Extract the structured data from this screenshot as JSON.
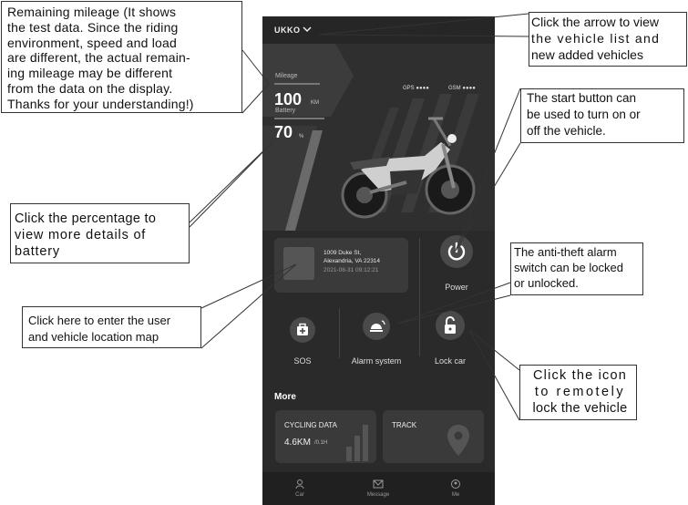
{
  "app": {
    "vehicle_name": "UKKO",
    "gps_label": "GPS ●●●●",
    "gsm_label": "GSM ●●●●",
    "mileage": {
      "label": "Mileage",
      "value": "100",
      "unit": "KM"
    },
    "battery": {
      "label": "Battery",
      "value": "70",
      "unit": "%"
    },
    "location": {
      "line1": "1009 Duke St,",
      "line2": "Alexandria, VA 22314",
      "timestamp": "2021-08-31 09:12:21"
    },
    "controls": {
      "power_label": "Power",
      "sos_label": "SOS",
      "alarm_label": "Alarm system",
      "lock_label": "Lock car"
    },
    "more_title": "More",
    "tiles": {
      "cycling_title": "CYCLING DATA",
      "cycling_value": "4.6KM",
      "cycling_unit": "/0.1H",
      "track_title": "TRACK"
    },
    "tabs": [
      {
        "label": "Car"
      },
      {
        "label": "Message"
      },
      {
        "label": "Me"
      }
    ]
  },
  "callouts": {
    "mileage": [
      "Remaining mileage (It shows",
      "the test data. Since the riding",
      "environment, speed and load",
      "are different, the actual remain-",
      "ing mileage may be different",
      "from the data on the display.",
      "Thanks for your understanding!)"
    ],
    "vehicle_list": [
      "Click the arrow to view",
      "the vehicle list and",
      "new added vehicles"
    ],
    "start": [
      "The start button can",
      "be used to turn on or",
      "off the vehicle."
    ],
    "battery": [
      "Click the percentage to",
      "view more details of",
      "battery"
    ],
    "alarm": [
      "The anti-theft alarm",
      "switch can be locked",
      "or unlocked."
    ],
    "map": [
      "Click here to enter the user",
      "and vehicle location map"
    ],
    "lock": [
      "Click the icon",
      "to remotely",
      "lock the vehicle"
    ]
  },
  "colors": {
    "phone_bg": "#2a2a2a",
    "card_bg": "#3a3a3a",
    "button_bg": "#4a4a4a",
    "callout_border": "#333333"
  }
}
